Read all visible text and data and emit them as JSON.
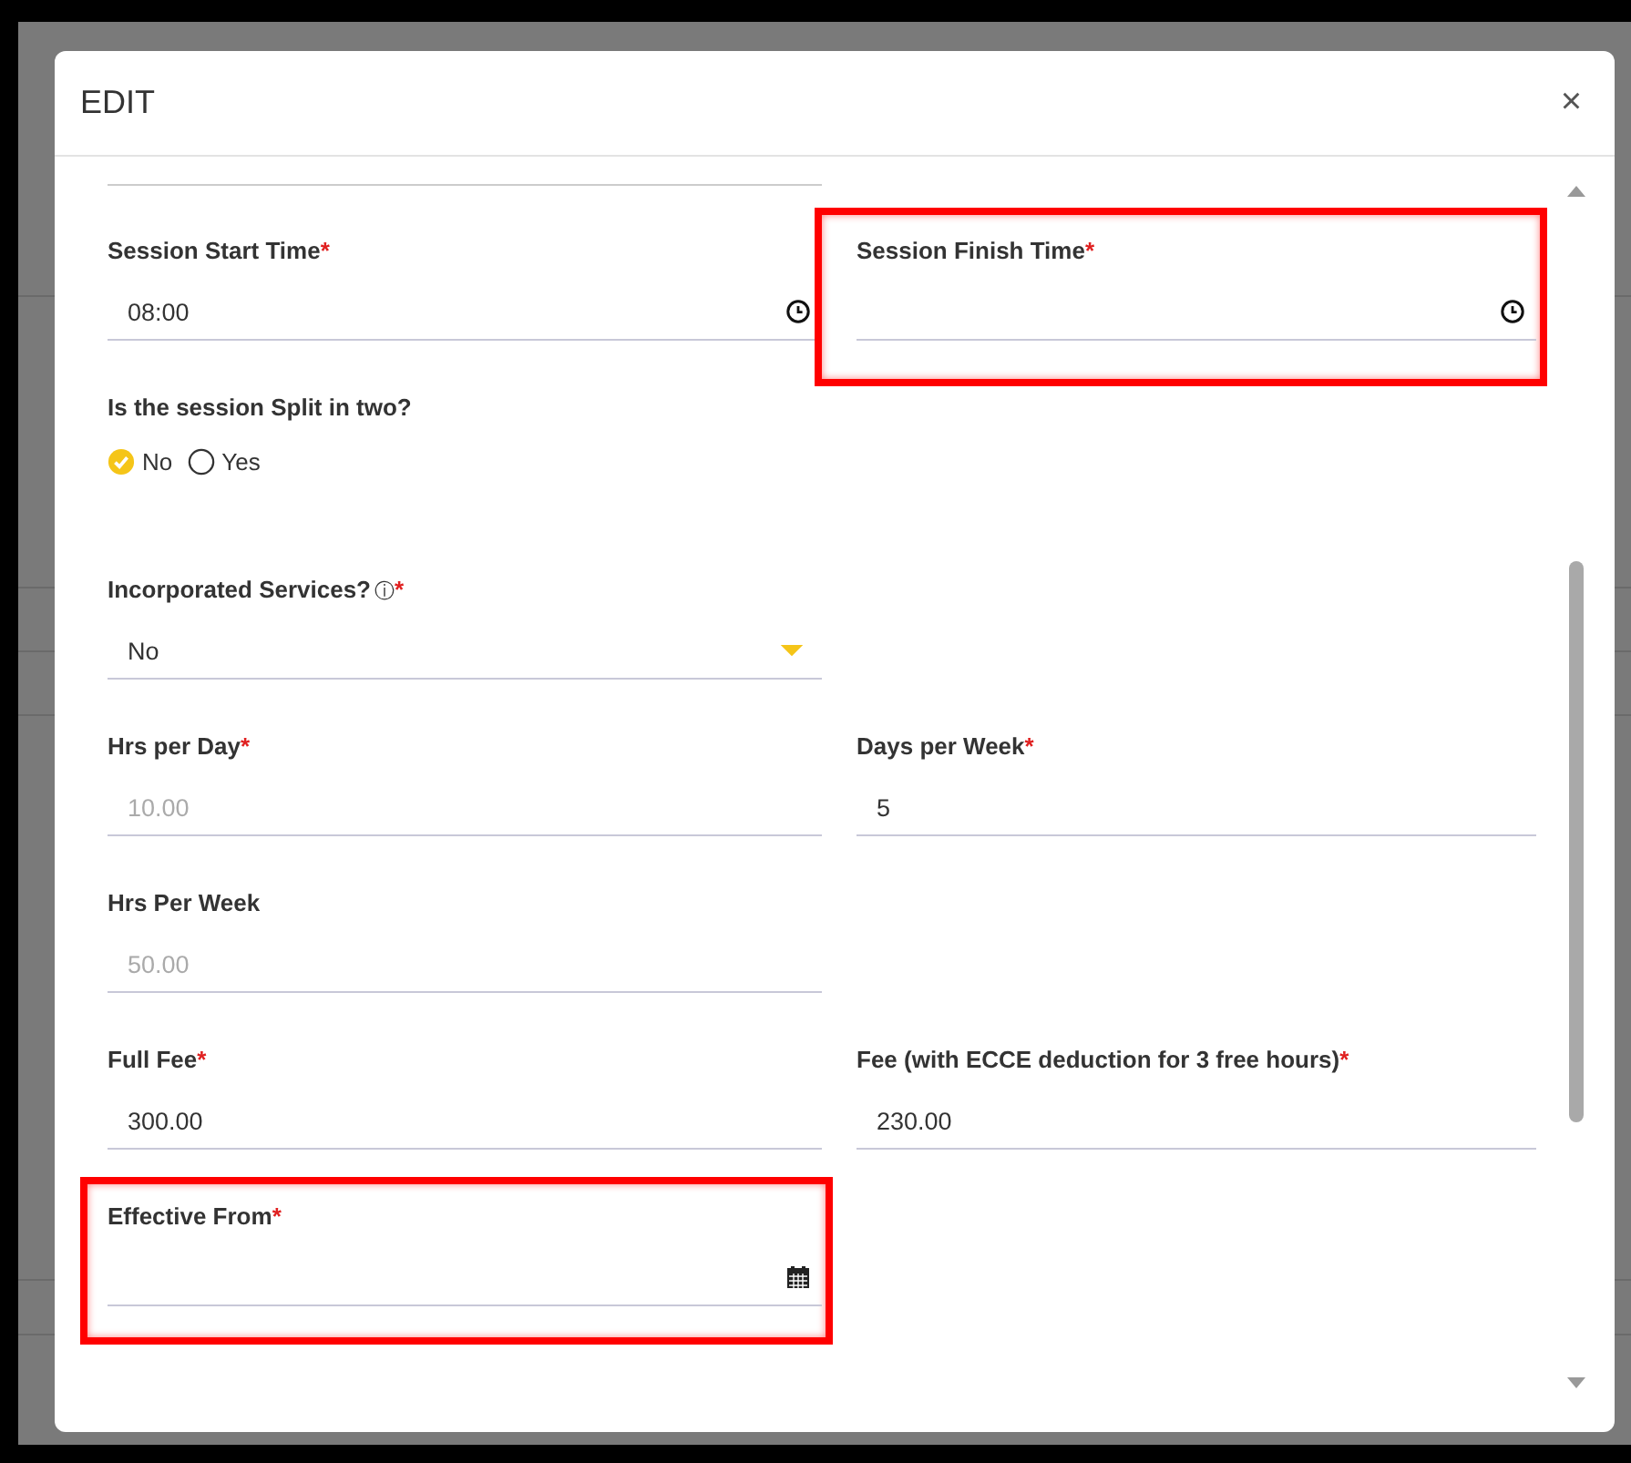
{
  "dialog": {
    "title": "EDIT",
    "close": "×"
  },
  "rows": [
    [
      {
        "kind": "time",
        "label": "Session Start Time",
        "required_mark": "*",
        "value": "08:00"
      },
      {
        "kind": "time",
        "label": "Session Finish Time",
        "required_mark": "*",
        "highlighted": true
      }
    ],
    [
      {
        "kind": "radio",
        "label": "Is the session Split in two?",
        "options": [
          {
            "label": "No",
            "selected": true
          },
          {
            "label": "Yes",
            "selected": false
          }
        ]
      }
    ],
    [
      {
        "kind": "select",
        "label": "Incorporated Services?",
        "info": "ⓘ",
        "required_mark": "*",
        "value": "No"
      }
    ],
    [
      {
        "kind": "text",
        "label": "Hrs per Day",
        "required_mark": "*",
        "value": "10.00",
        "disabled": true
      },
      {
        "kind": "text",
        "label": "Days per Week",
        "required_mark": "*",
        "value": "5"
      }
    ],
    [
      {
        "kind": "text",
        "label": "Hrs Per Week",
        "value": "50.00",
        "disabled": true
      }
    ],
    [
      {
        "kind": "text",
        "label": "Full Fee",
        "required_mark": "*",
        "value": "300.00"
      },
      {
        "kind": "text",
        "label": "Fee (with ECCE deduction for 3 free hours)",
        "required_mark": "*",
        "value": "230.00"
      }
    ],
    [
      {
        "kind": "date",
        "label": "Effective From",
        "required_mark": "*",
        "highlighted": true
      }
    ]
  ]
}
